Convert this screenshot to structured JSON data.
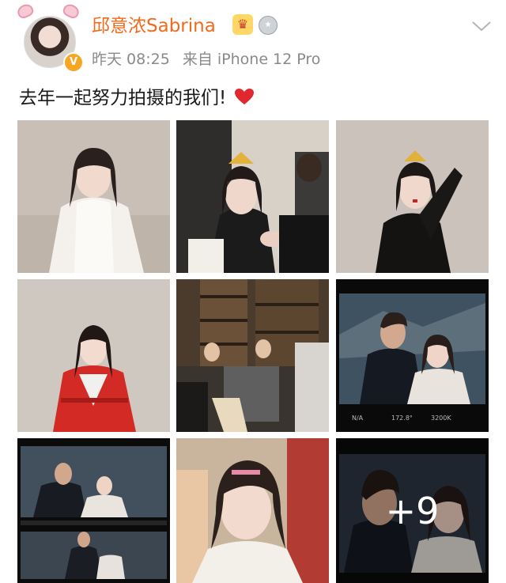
{
  "user": {
    "name": "邱意浓Sabrina",
    "verified_badge": "V",
    "icons": [
      "crown-icon",
      "medal-icon",
      "chevron-down-icon"
    ]
  },
  "meta": {
    "time": "昨天 08:25",
    "source": "来自 iPhone 12 Pro"
  },
  "post": {
    "text": "去年一起努力拍摄的我们!",
    "emoji": "heart-icon"
  },
  "photos": {
    "more_count": "+9"
  },
  "colors": {
    "username": "#f26a1b",
    "meta": "#8a8a8a",
    "heart": "#e0282e",
    "badge": "#f5a623"
  }
}
